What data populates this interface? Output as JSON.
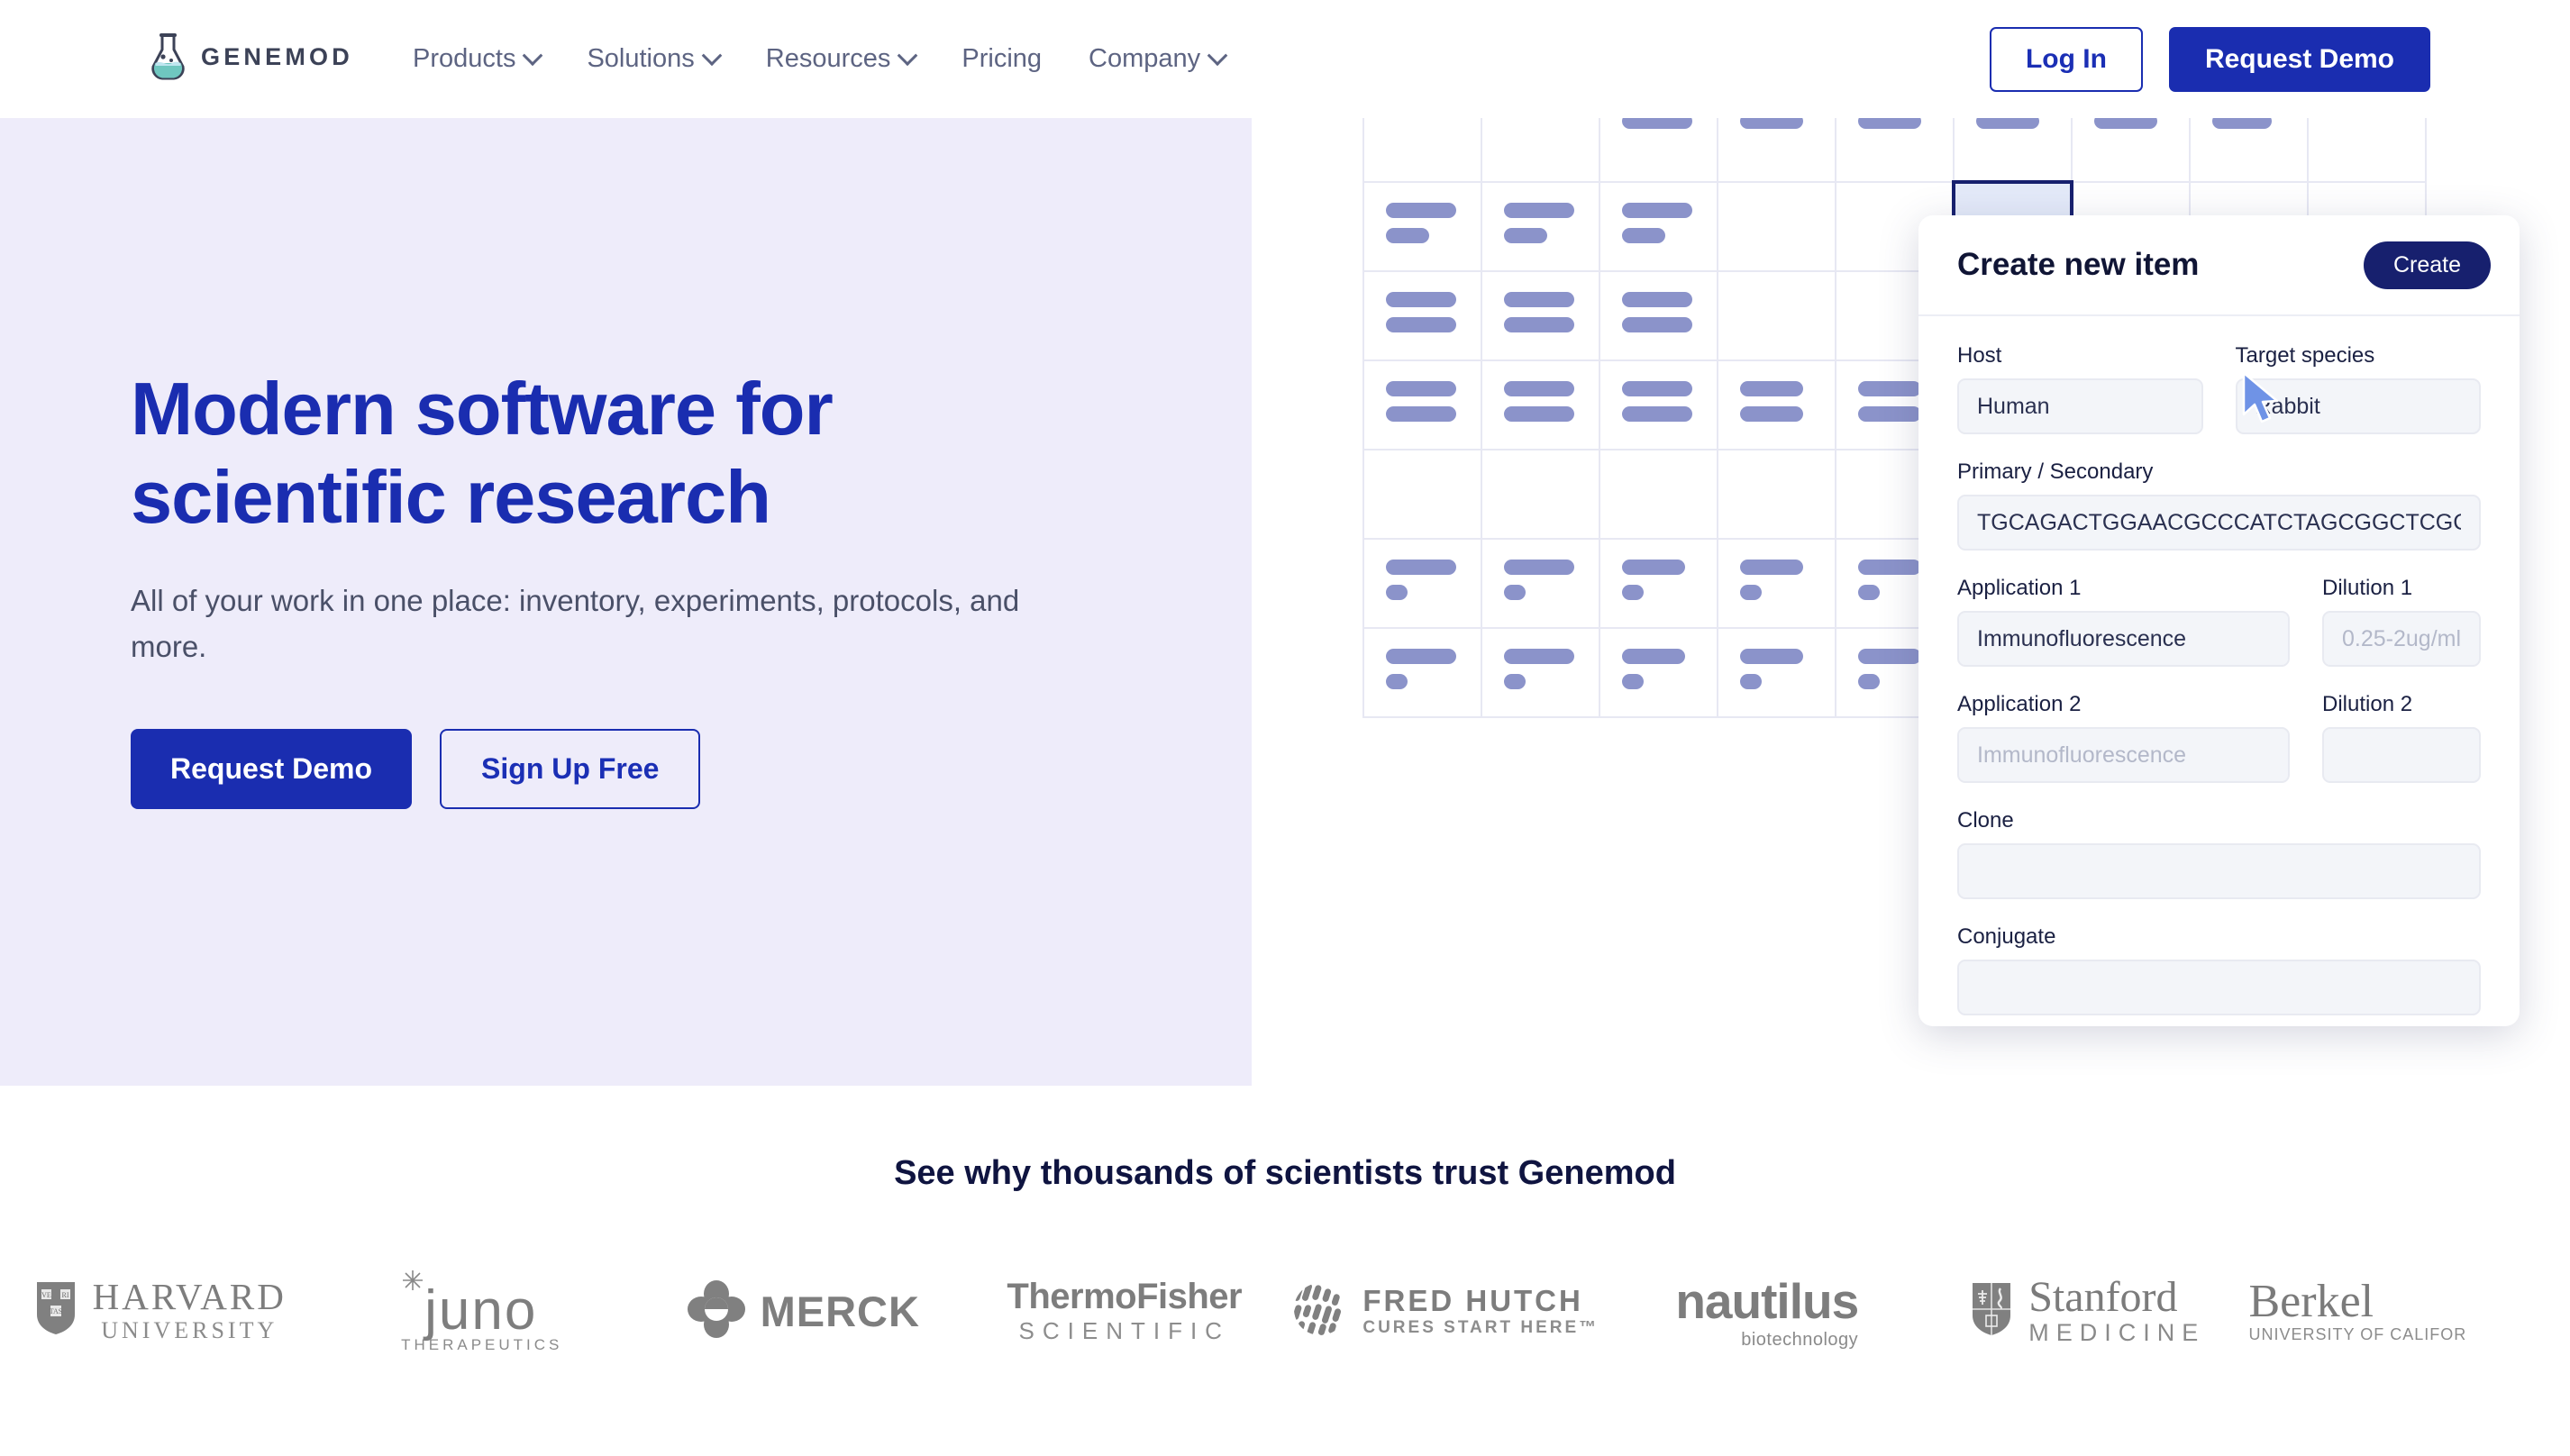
{
  "brand": {
    "name": "GENEMOD",
    "accent": "#1a2db0",
    "logo_icon": "flask-icon"
  },
  "nav": {
    "items": [
      {
        "label": "Products",
        "has_caret": true
      },
      {
        "label": "Solutions",
        "has_caret": true
      },
      {
        "label": "Resources",
        "has_caret": true
      },
      {
        "label": "Pricing",
        "has_caret": false
      },
      {
        "label": "Company",
        "has_caret": true
      }
    ],
    "login_label": "Log In",
    "demo_label": "Request Demo"
  },
  "hero": {
    "title_line1": "Modern software for",
    "title_line2": "scientific research",
    "subtitle": "All of your work in one place: inventory, experiments, protocols, and more.",
    "primary_cta": "Request Demo",
    "secondary_cta": "Sign Up Free",
    "bg_color": "#eeecfa"
  },
  "panel": {
    "title": "Create new item",
    "create_label": "Create",
    "fields": [
      {
        "label": "Host",
        "value": "Human",
        "placeholder": ""
      },
      {
        "label": "Target species",
        "value": "Rabbit",
        "placeholder": ""
      },
      {
        "label": "Primary / Secondary",
        "value": "TGCAGACTGGAACGCCCATCTAGCGGCTCGCGTCT",
        "placeholder": ""
      },
      {
        "label": "Application 1",
        "value": "Immunofluorescence",
        "placeholder": ""
      },
      {
        "label": "Dilution 1",
        "value": "",
        "placeholder": "0.25-2ug/ml"
      },
      {
        "label": "Application 2",
        "value": "",
        "placeholder": "Immunofluorescence"
      },
      {
        "label": "Dilution 2",
        "value": "",
        "placeholder": ""
      },
      {
        "label": "Clone",
        "value": "",
        "placeholder": ""
      },
      {
        "label": "Conjugate",
        "value": "",
        "placeholder": ""
      }
    ]
  },
  "trust": {
    "heading": "See why thousands of scientists trust Genemod",
    "logos": [
      {
        "name": "Harvard University",
        "line1": "HARVARD",
        "line2": "UNIVERSITY",
        "icon": "harvard-shield-icon"
      },
      {
        "name": "Juno Therapeutics",
        "line1": "juno",
        "line2": "THERAPEUTICS",
        "icon": "juno-snowflake-icon"
      },
      {
        "name": "Merck",
        "line1": "MERCK",
        "line2": "",
        "icon": "merck-clover-icon"
      },
      {
        "name": "Thermo Fisher Scientific",
        "line1": "ThermoFisher",
        "line2": "SCIENTIFIC",
        "icon": ""
      },
      {
        "name": "Fred Hutch",
        "line1": "FRED HUTCH",
        "line2": "CURES START HERE™",
        "icon": "fred-hutch-circle-icon"
      },
      {
        "name": "Nautilus Biotechnology",
        "line1": "nautilus",
        "line2": "biotechnology",
        "icon": ""
      },
      {
        "name": "Stanford Medicine",
        "line1": "Stanford",
        "line2": "MEDICINE",
        "icon": "stanford-shield-icon"
      },
      {
        "name": "Berkeley",
        "line1": "Berkel",
        "line2": "UNIVERSITY OF CALIFOR",
        "icon": ""
      }
    ]
  },
  "grid": {
    "selected_cell": {
      "row": 3,
      "col": 5
    },
    "rows": [
      [
        [
          96
        ],
        [
          96
        ],
        [
          96
        ],
        [
          82
        ],
        [
          72
        ],
        [
          72
        ],
        [
          66
        ],
        [
          66
        ],
        [
          56
        ]
      ],
      [
        [
          78
        ],
        [
          78
        ],
        [
          78
        ],
        [
          70
        ],
        [
          70
        ],
        [
          70
        ],
        [
          70
        ],
        [
          0
        ],
        [
          0
        ]
      ],
      [
        [
          0
        ],
        [
          0
        ],
        [
          78
        ],
        [
          70
        ],
        [
          70
        ],
        [
          70
        ],
        [
          70
        ],
        [
          66
        ],
        [
          0
        ]
      ],
      [
        [
          78,
          48
        ],
        [
          78,
          48
        ],
        [
          78,
          48
        ],
        [
          0
        ],
        [
          0
        ],
        [
          0
        ],
        [
          0
        ],
        [
          0
        ],
        [
          0
        ]
      ],
      [
        [
          78,
          78
        ],
        [
          78,
          78
        ],
        [
          78,
          78
        ],
        [
          0
        ],
        [
          0
        ],
        [
          0
        ],
        [
          0
        ],
        [
          0
        ],
        [
          0
        ]
      ],
      [
        [
          78,
          78
        ],
        [
          78,
          78
        ],
        [
          78,
          78
        ],
        [
          70,
          70
        ],
        [
          70,
          70
        ],
        [
          70,
          70
        ],
        [
          70,
          70
        ],
        [
          0
        ],
        [
          0
        ]
      ],
      [
        [
          0
        ],
        [
          0
        ],
        [
          0
        ],
        [
          0
        ],
        [
          0
        ],
        [
          0
        ],
        [
          56,
          56
        ],
        [
          0
        ],
        [
          0
        ]
      ],
      [
        [
          78,
          24
        ],
        [
          78,
          24
        ],
        [
          70,
          24
        ],
        [
          70,
          24
        ],
        [
          70,
          24
        ],
        [
          70,
          24
        ],
        [
          70,
          24
        ],
        [
          0
        ],
        [
          0
        ]
      ],
      [
        [
          78,
          24
        ],
        [
          78,
          24
        ],
        [
          70,
          24
        ],
        [
          70,
          24
        ],
        [
          70,
          24
        ],
        [
          70,
          24
        ],
        [
          70,
          24
        ],
        [
          0
        ],
        [
          0
        ]
      ]
    ]
  }
}
